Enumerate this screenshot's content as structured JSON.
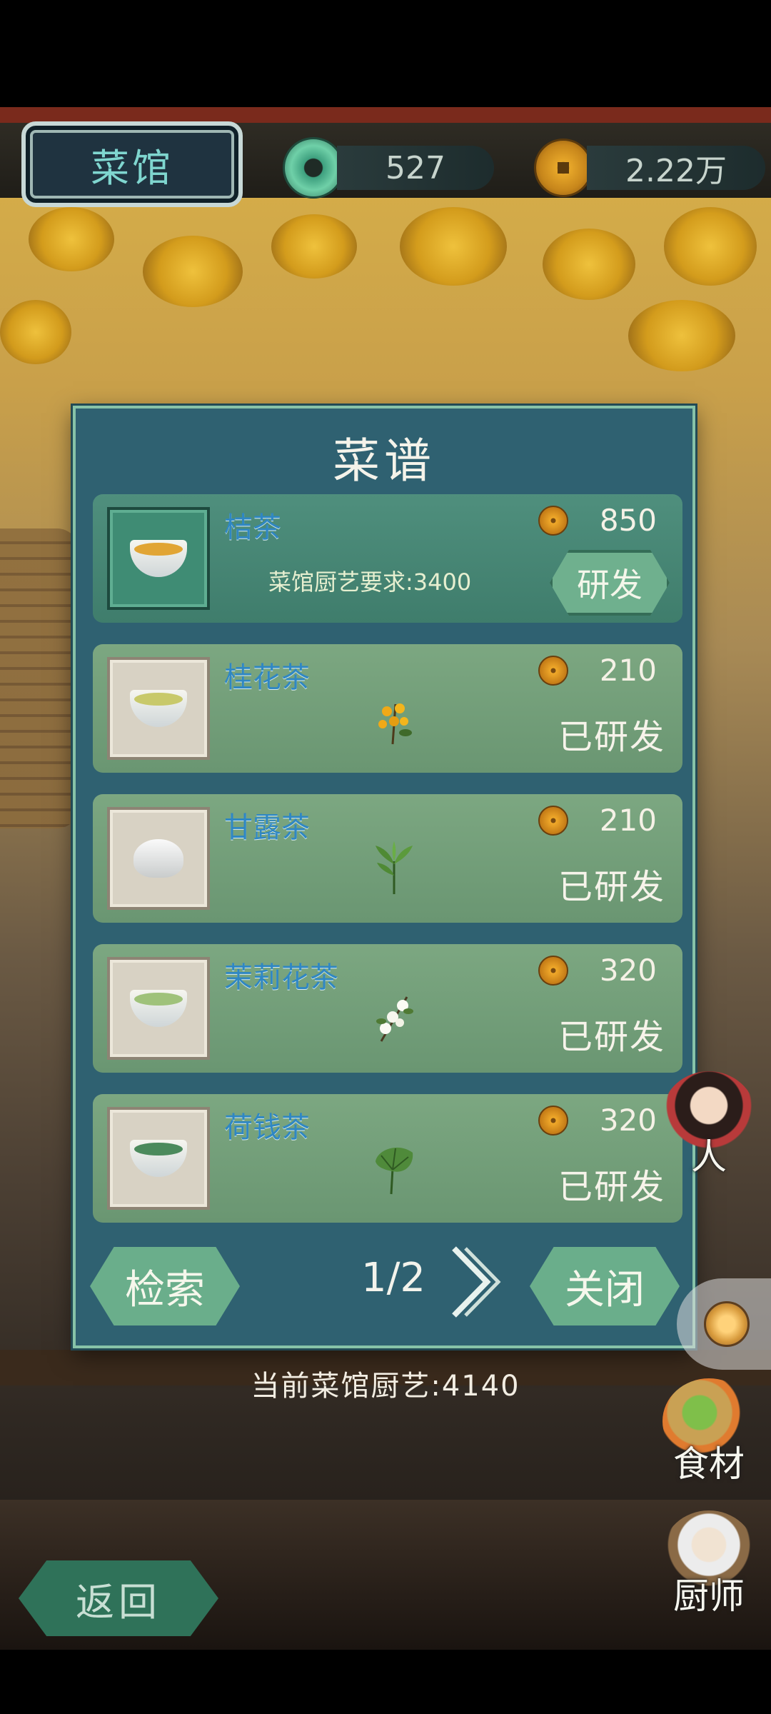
{
  "header": {
    "shop_label": "菜馆",
    "jade_currency": "527",
    "copper_currency": "2.22万"
  },
  "panel": {
    "title": "菜谱",
    "recipes": [
      {
        "name": "桔茶",
        "price": "850",
        "requirement": "菜馆厨艺要求:3400",
        "action": "研发",
        "locked": true,
        "icon": "tangerine-tea-icon"
      },
      {
        "name": "桂花茶",
        "price": "210",
        "status": "已研发",
        "icon": "osmanthus-tea-icon",
        "herb": "osmanthus-sprig-icon"
      },
      {
        "name": "甘露茶",
        "price": "210",
        "status": "已研发",
        "icon": "teapot-icon",
        "herb": "tea-leaf-icon"
      },
      {
        "name": "茉莉花茶",
        "price": "320",
        "status": "已研发",
        "icon": "jasmine-tea-icon",
        "herb": "jasmine-sprig-icon"
      },
      {
        "name": "荷钱茶",
        "price": "320",
        "status": "已研发",
        "icon": "lotus-tea-icon",
        "herb": "lotus-leaf-icon"
      }
    ],
    "search_label": "检索",
    "page": "1/2",
    "close_label": "关闭"
  },
  "craft_level": "当前菜馆厨艺:4140",
  "back_label": "返回",
  "side_menu": {
    "people_label": "人",
    "ingredients_label": "食材",
    "chef_label": "厨师"
  },
  "colors": {
    "panel": "#2f6171",
    "card": "#6a9672",
    "card_locked": "#3f7d6c",
    "name_blue": "#2f87c3",
    "button_green": "#6aae8b"
  }
}
